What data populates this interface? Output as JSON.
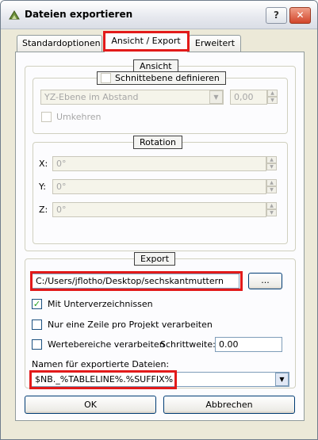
{
  "window": {
    "title": "Dateien exportieren",
    "help_label": "?",
    "close_label": "✕"
  },
  "tabs": [
    {
      "label": "Standardoptionen"
    },
    {
      "label": "Ansicht / Export"
    },
    {
      "label": "Erweitert"
    }
  ],
  "ansicht": {
    "title": "Ansicht",
    "schnitt_label": "Schnittebene definieren",
    "plane_select": "YZ-Ebene im Abstand",
    "distance_value": "0,00",
    "umkehren_label": "Umkehren"
  },
  "rotation": {
    "title": "Rotation",
    "x_label": "X:",
    "x_value": "0°",
    "y_label": "Y:",
    "y_value": "0°",
    "z_label": "Z:",
    "z_value": "0°"
  },
  "export": {
    "title": "Export",
    "path_value": "C:/Users/jflotho/Desktop/sechskantmuttern",
    "browse_label": "...",
    "subdirs_label": "Mit Unterverzeichnissen",
    "subdirs_checked": true,
    "one_line_label": "Nur eine Zeile pro Projekt verarbeiten",
    "ranges_label": "Wertebereiche verarbeiten",
    "step_label": "Schrittweite:",
    "step_value": "0.00",
    "names_label": "Namen für exportierte Dateien:",
    "names_value": "$NB._%TABLELINE%.%SUFFIX%"
  },
  "buttons": {
    "ok": "OK",
    "cancel": "Abbrechen"
  },
  "colors": {
    "highlight": "#e21a1a",
    "panel": "#fcfcfe",
    "dialog": "#ece9d8"
  }
}
